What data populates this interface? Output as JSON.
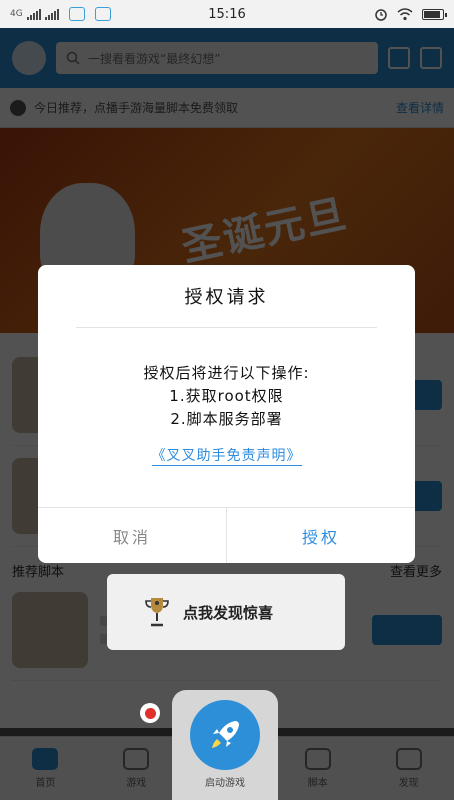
{
  "status_bar": {
    "network": "4G",
    "time": "15:16"
  },
  "background_app": {
    "search_placeholder": "一搜看看游戏“最终幻想”",
    "notice_text": "今日推荐，点播手游海量脚本免费领取",
    "notice_link": "查看详情",
    "banner_text": "圣诞元旦",
    "section_title": "推荐脚本",
    "section_more": "查看更多",
    "tabs": [
      {
        "label": "首页"
      },
      {
        "label": "游戏"
      },
      {
        "label": "脚本"
      },
      {
        "label": "发现"
      }
    ]
  },
  "dialog": {
    "title": "授权请求",
    "intro": "授权后将进行以下操作:",
    "steps": [
      "1.获取root权限",
      "2.脚本服务部署"
    ],
    "disclaimer": "《叉叉助手免责声明》",
    "cancel_label": "取消",
    "confirm_label": "授权"
  },
  "surprise_popup": {
    "label": "点我发现惊喜"
  },
  "launcher": {
    "label": "启动游戏"
  },
  "colors": {
    "accent": "#2f8de0",
    "overlay": "#1b1b1b",
    "record_dot": "#e0302a"
  }
}
